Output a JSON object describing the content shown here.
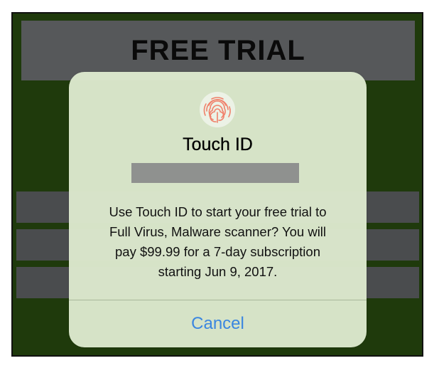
{
  "banner": {
    "title": "FREE TRIAL"
  },
  "alert": {
    "icon": "fingerprint-icon",
    "title": "Touch ID",
    "message_lines": [
      "Use Touch ID to start your free trial to",
      "Full Virus, Malware scanner? You will",
      "pay $99.99 for a 7-day subscription",
      "starting Jun 9, 2017."
    ],
    "cancel_label": "Cancel"
  },
  "colors": {
    "background": "#1f3a0c",
    "banner": "#56585a",
    "alert": "#dce8cd",
    "accent": "#3a86e0",
    "fingerprint": "#f0806a"
  }
}
